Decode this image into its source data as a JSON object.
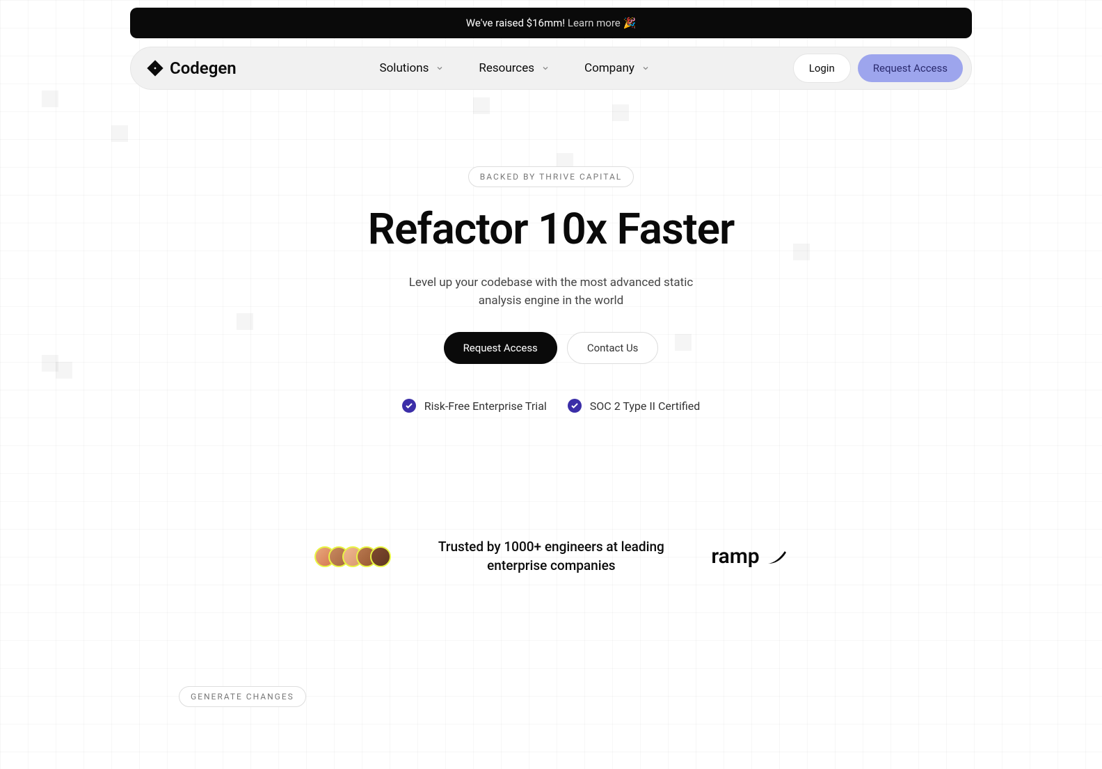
{
  "announcement": {
    "text": "We've raised $16mm!",
    "link_text": "Learn more",
    "emoji": "🎉"
  },
  "brand": {
    "name": "Codegen"
  },
  "nav": {
    "items": [
      {
        "label": "Solutions"
      },
      {
        "label": "Resources"
      },
      {
        "label": "Company"
      }
    ],
    "login_label": "Login",
    "cta_label": "Request Access"
  },
  "hero": {
    "pill": "BACKED BY THRIVE CAPITAL",
    "title": "Refactor 10x Faster",
    "subtitle": "Level up your codebase with the most advanced static analysis engine in the world",
    "primary_cta": "Request Access",
    "secondary_cta": "Contact Us",
    "badges": [
      {
        "label": "Risk-Free Enterprise Trial"
      },
      {
        "label": "SOC 2 Type II Certified"
      }
    ]
  },
  "social_proof": {
    "text": "Trusted by 1000+ engineers at leading enterprise companies",
    "partner": "ramp"
  },
  "section": {
    "tag": "GENERATE CHANGES"
  },
  "colors": {
    "accent": "#9da5ed",
    "check": "#3b2ea8",
    "black": "#0a0a0a"
  }
}
